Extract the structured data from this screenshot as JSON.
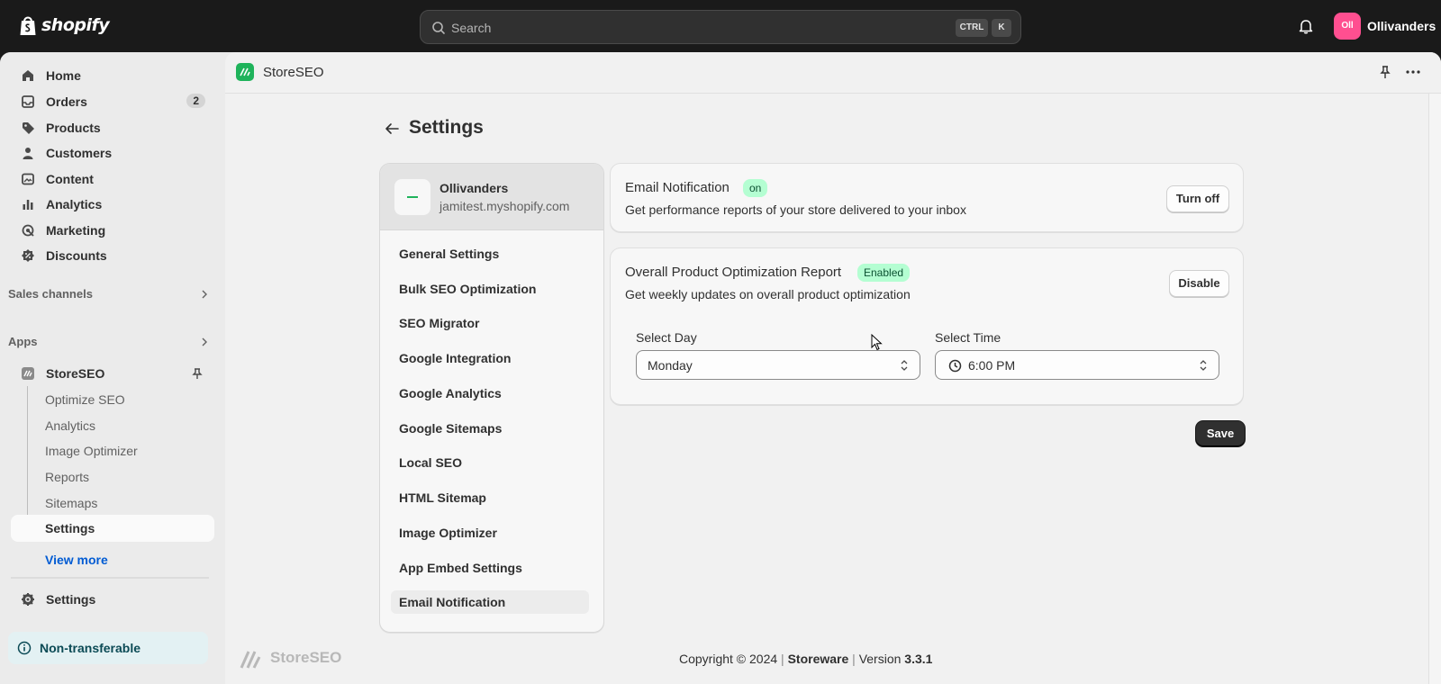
{
  "topbar": {
    "brand": "shopify",
    "search_placeholder": "Search",
    "shortcut_ctrl": "CTRL",
    "shortcut_k": "K",
    "account_initials": "Oll",
    "account_name": "Ollivanders"
  },
  "sidebar": {
    "items": [
      {
        "label": "Home",
        "icon": "home-icon"
      },
      {
        "label": "Orders",
        "icon": "inbox-icon",
        "badge": "2"
      },
      {
        "label": "Products",
        "icon": "tag-icon"
      },
      {
        "label": "Customers",
        "icon": "person-icon"
      },
      {
        "label": "Content",
        "icon": "image-icon"
      },
      {
        "label": "Analytics",
        "icon": "bar-chart-icon"
      },
      {
        "label": "Marketing",
        "icon": "target-icon"
      },
      {
        "label": "Discounts",
        "icon": "discount-icon"
      }
    ],
    "sales_channels": "Sales channels",
    "apps": "Apps",
    "app_name": "StoreSEO",
    "app_sub_items": [
      "Optimize SEO",
      "Analytics",
      "Image Optimizer",
      "Reports",
      "Sitemaps",
      "Settings"
    ],
    "view_more": "View more",
    "settings": "Settings",
    "non_transferable": "Non-transferable"
  },
  "app_header": {
    "name": "StoreSEO"
  },
  "page": {
    "title": "Settings"
  },
  "store": {
    "name": "Ollivanders",
    "domain": "jamitest.myshopify.com"
  },
  "settings_menu": [
    "General Settings",
    "Bulk SEO Optimization",
    "SEO Migrator",
    "Google Integration",
    "Google Analytics",
    "Google Sitemaps",
    "Local SEO",
    "HTML Sitemap",
    "Image Optimizer",
    "App Embed Settings",
    "Email Notification"
  ],
  "email_card": {
    "title": "Email Notification",
    "status": "on",
    "description": "Get performance reports of your store delivered to your inbox",
    "button": "Turn off"
  },
  "report_card": {
    "title": "Overall Product Optimization Report",
    "status": "Enabled",
    "description": "Get weekly updates on overall product optimization",
    "button": "Disable",
    "day_label": "Select Day",
    "day_value": "Monday",
    "time_label": "Select Time",
    "time_value": "6:00 PM"
  },
  "save_label": "Save",
  "footer": {
    "logo_text": "StoreSEO",
    "copyright": "Copyright © 2024",
    "company": "Storeware",
    "version_label": "Version",
    "version": "3.3.1"
  },
  "colors": {
    "accent_green": "#1fb35b",
    "badge_green_bg": "#b4fed2",
    "topbar": "#1a1a1a",
    "link_blue": "#005bd3"
  }
}
